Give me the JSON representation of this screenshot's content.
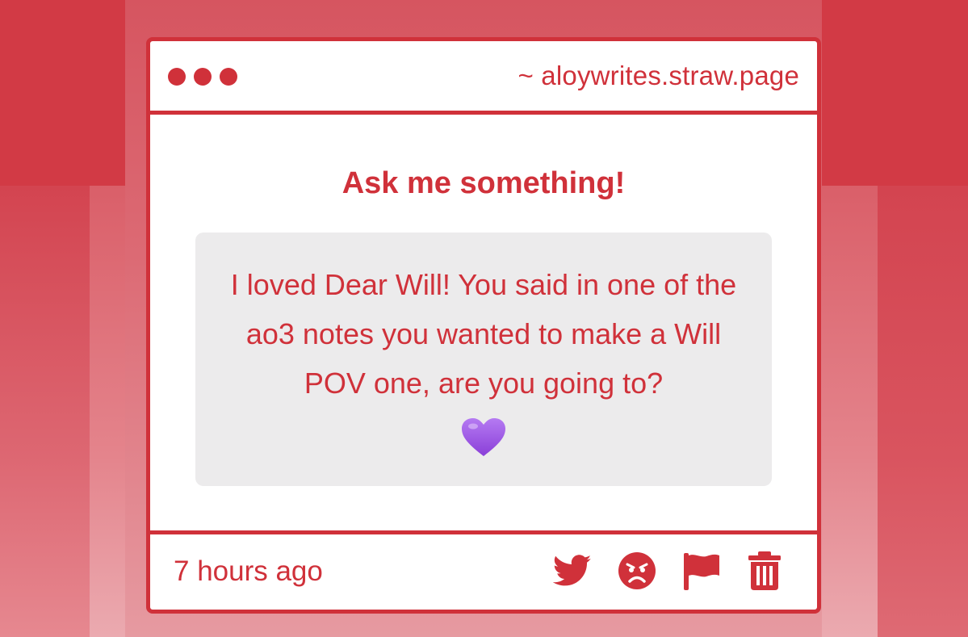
{
  "window": {
    "url": "~ aloywrites.straw.page"
  },
  "card": {
    "heading": "Ask me something!",
    "question": "I loved Dear Will! You said in one of the ao3 notes you wanted to make a Will POV one, are you going to?",
    "emoji": "purple-heart-emoji",
    "timestamp": "7 hours ago"
  },
  "actions": [
    {
      "icon": "twitter-icon"
    },
    {
      "icon": "angry-face-icon"
    },
    {
      "icon": "flag-icon"
    },
    {
      "icon": "trash-icon"
    }
  ],
  "colors": {
    "accent": "#d0313a",
    "question_bg": "#ecebec",
    "heart": "#9b4fe0"
  }
}
